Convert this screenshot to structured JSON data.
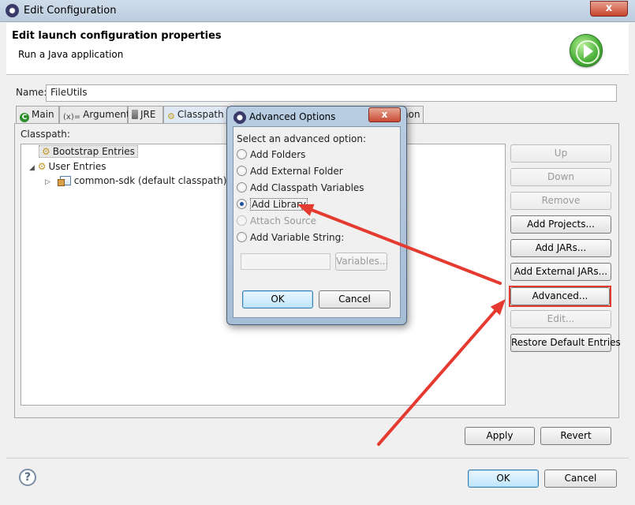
{
  "window": {
    "title": "Edit Configuration",
    "close_glyph": "x"
  },
  "header": {
    "title": "Edit launch configuration properties",
    "subtitle": "Run a Java application",
    "icon": "run-icon"
  },
  "name_field": {
    "label": "Name:",
    "value": "FileUtils"
  },
  "tabs": [
    {
      "label": "Main",
      "icon": "main-tab-icon",
      "glyph": "C"
    },
    {
      "label": "Arguments",
      "icon": "arguments-tab-icon",
      "glyph": "(x)="
    },
    {
      "label": "JRE",
      "icon": "jre-tab-icon",
      "glyph": ""
    },
    {
      "label": "Classpath",
      "icon": "classpath-tab-icon",
      "glyph": "⚙"
    },
    {
      "label": "non",
      "icon": "",
      "glyph": ""
    }
  ],
  "classpath": {
    "label": "Classpath:",
    "tree": [
      {
        "label": "Bootstrap Entries",
        "level": 1,
        "expanded": null,
        "selected": true
      },
      {
        "label": "User Entries",
        "level": 1,
        "expanded": true,
        "selected": false
      },
      {
        "label": "common-sdk (default classpath)",
        "level": 2,
        "expanded": false,
        "selected": false
      }
    ],
    "twisty_expanded": "◢",
    "twisty_collapsed": "▷",
    "fold_glyph": "⚙"
  },
  "side_buttons": {
    "up": "Up",
    "down": "Down",
    "remove": "Remove",
    "add_projects": "Add Projects...",
    "add_jars": "Add JARs...",
    "add_external_jars": "Add External JARs...",
    "advanced": "Advanced...",
    "edit": "Edit...",
    "restore_default": "Restore Default Entries"
  },
  "footer": {
    "apply": "Apply",
    "revert": "Revert",
    "ok": "OK",
    "cancel": "Cancel",
    "help_glyph": "?"
  },
  "dialog": {
    "title": "Advanced Options",
    "close_glyph": "x",
    "prompt": "Select an advanced option:",
    "options": [
      {
        "label": "Add Folders",
        "selected": false,
        "enabled": true
      },
      {
        "label": "Add External Folder",
        "selected": false,
        "enabled": true
      },
      {
        "label": "Add Classpath Variables",
        "selected": false,
        "enabled": true
      },
      {
        "label": "Add Library",
        "selected": true,
        "enabled": true
      },
      {
        "label": "Attach Source",
        "selected": false,
        "enabled": false
      },
      {
        "label": "Add Variable String:",
        "selected": false,
        "enabled": true
      }
    ],
    "variable_value": "",
    "variables_button": "Variables...",
    "ok": "OK",
    "cancel": "Cancel"
  },
  "annotation": {
    "color": "#e53a2f"
  }
}
